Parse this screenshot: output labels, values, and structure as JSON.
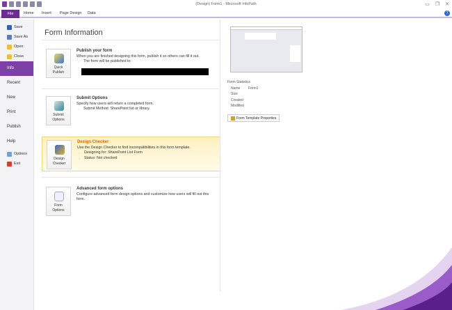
{
  "window": {
    "title": "(Design) Form1 - Microsoft InfoPath"
  },
  "ribbon": {
    "file": "File",
    "tabs": [
      "Home",
      "Insert",
      "Page Design",
      "Data"
    ]
  },
  "sidebar": {
    "items": [
      "Save",
      "Save As",
      "Open",
      "Close"
    ],
    "active": "Info",
    "big": [
      "Recent",
      "New",
      "Print",
      "Publish",
      "Help"
    ],
    "bottom": [
      "Options",
      "Exit"
    ]
  },
  "main": {
    "heading": "Form Information",
    "sections": [
      {
        "button": [
          "Quick",
          "Publish"
        ],
        "title": "Publish your form",
        "desc": "When you are finished designing this form, publish it so others can fill it out.",
        "bullets": [
          "The form will be published to:"
        ]
      },
      {
        "button": [
          "Submit",
          "Options"
        ],
        "title": "Submit Options",
        "desc": "Specify how users will return a completed form.",
        "bullets": [
          "Submit Method: SharePoint list or library."
        ]
      },
      {
        "button": [
          "Design",
          "Checker"
        ],
        "title": "Design Checker",
        "desc": "Use the Design Checker to find incompatibilities in this form template.",
        "bullets": [
          "Designing for: SharePoint List Form",
          "Status: Not checked"
        ]
      },
      {
        "button": [
          "Form",
          "Options"
        ],
        "title": "Advanced form options",
        "desc": "Configure advanced form design options and customize how users will fill out this form.",
        "bullets": []
      }
    ]
  },
  "stats": {
    "title": "Form Statistics",
    "rows": [
      [
        "Name",
        "Form1"
      ],
      [
        "Size",
        ""
      ],
      [
        "Created",
        ""
      ],
      [
        "Modified",
        ""
      ]
    ],
    "button": "Form Template Properties"
  },
  "colors": {
    "accent": "#6b2c91",
    "highlight": "#fdf0c0",
    "title_orange": "#d86a00"
  }
}
